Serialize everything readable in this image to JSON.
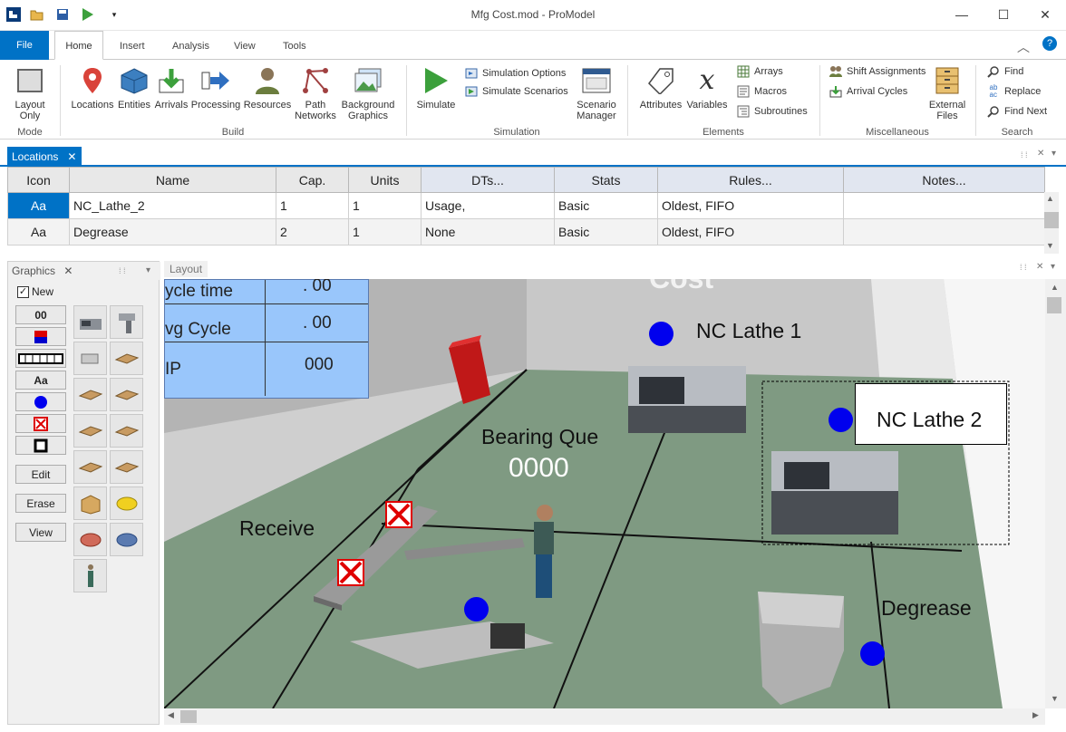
{
  "window": {
    "title": "Mfg Cost.mod - ProModel"
  },
  "ribbon_tabs": [
    "File",
    "Home",
    "Insert",
    "Analysis",
    "View",
    "Tools"
  ],
  "ribbon": {
    "mode": {
      "layout_only": "Layout\nOnly",
      "group": "Mode"
    },
    "build": {
      "items": [
        "Locations",
        "Entities",
        "Arrivals",
        "Processing",
        "Resources",
        "Path\nNetworks",
        "Background\nGraphics"
      ],
      "group": "Build"
    },
    "simulation": {
      "simulate": "Simulate",
      "options": "Simulation Options",
      "scenarios": "Simulate Scenarios",
      "manager": "Scenario\nManager",
      "group": "Simulation"
    },
    "elements": {
      "attributes": "Attributes",
      "variables": "Variables",
      "arrays": "Arrays",
      "macros": "Macros",
      "subroutines": "Subroutines",
      "group": "Elements"
    },
    "misc": {
      "shift": "Shift Assignments",
      "arrival_cycles": "Arrival Cycles",
      "external": "External\nFiles",
      "group": "Miscellaneous"
    },
    "search": {
      "find": "Find",
      "replace": "Replace",
      "find_next": "Find Next",
      "group": "Search"
    }
  },
  "locations": {
    "tab": "Locations",
    "columns": [
      "Icon",
      "Name",
      "Cap.",
      "Units",
      "DTs...",
      "Stats",
      "Rules...",
      "Notes..."
    ],
    "rows": [
      {
        "icon": "Aa",
        "name": "NC_Lathe_2",
        "cap": "1",
        "units": "1",
        "dts": "Usage,",
        "stats": "Basic",
        "rules": "Oldest, FIFO",
        "notes": ""
      },
      {
        "icon": "Aa",
        "name": "Degrease",
        "cap": "2",
        "units": "1",
        "dts": "None",
        "stats": "Basic",
        "rules": "Oldest, FIFO",
        "notes": ""
      }
    ]
  },
  "graphics": {
    "title": "Graphics",
    "new_label": "New",
    "counter_label": "00",
    "text_label": "Aa",
    "edit": "Edit",
    "erase": "Erase",
    "view": "View"
  },
  "layout": {
    "title": "Layout",
    "stats_panel": [
      {
        "label": "ycle time",
        "value": ". 00"
      },
      {
        "label": "vg Cycle",
        "value": ". 00"
      },
      {
        "label": "IP",
        "value": "000"
      }
    ],
    "labels": {
      "nc_lathe_1": "NC Lathe 1",
      "nc_lathe_2": "NC Lathe 2",
      "bearing_que": "Bearing Que",
      "bearing_count": "0000",
      "receive": "Receive",
      "degrease": "Degrease"
    }
  },
  "colors": {
    "accent": "#0072c6",
    "floor": "#7f9a82",
    "dot": "#0000ee",
    "stats_bg": "#99c6fb"
  }
}
